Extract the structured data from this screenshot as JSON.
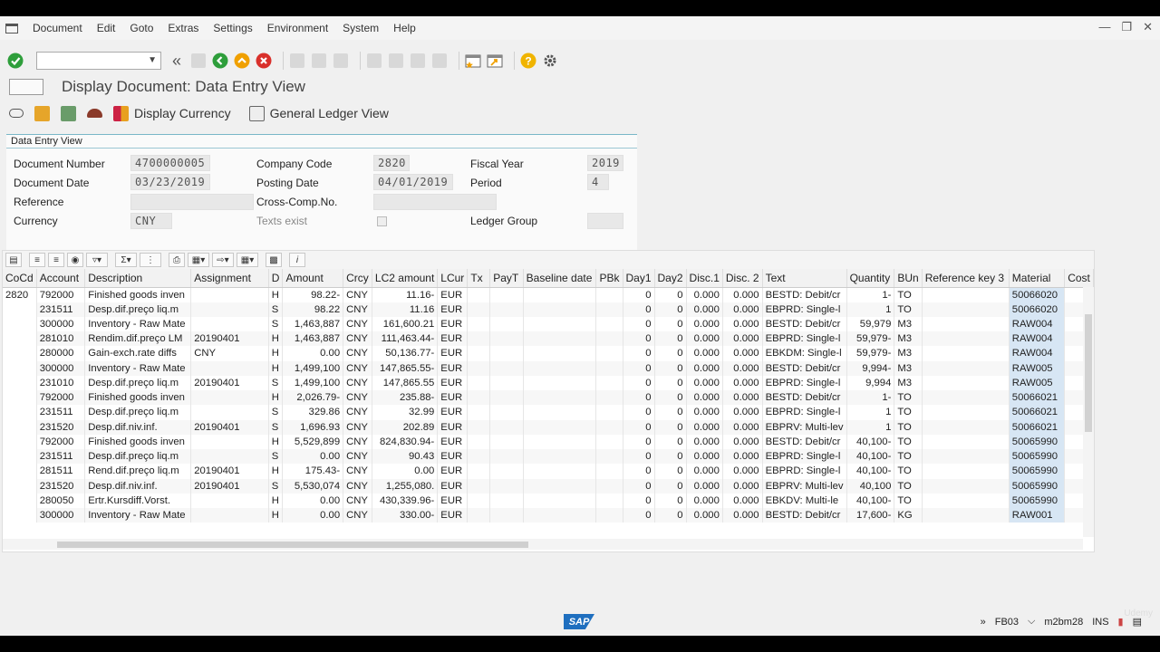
{
  "menu": [
    "Document",
    "Edit",
    "Goto",
    "Extras",
    "Settings",
    "Environment",
    "System",
    "Help"
  ],
  "title": "Display Document: Data Entry View",
  "app_toolbar": {
    "display_currency": "Display Currency",
    "general_ledger_view": "General Ledger View"
  },
  "panel": {
    "title": "Data Entry View",
    "document_number_label": "Document Number",
    "document_number": "4700000005",
    "company_code_label": "Company Code",
    "company_code": "2820",
    "fiscal_year_label": "Fiscal Year",
    "fiscal_year": "2019",
    "document_date_label": "Document Date",
    "document_date": "03/23/2019",
    "posting_date_label": "Posting Date",
    "posting_date": "04/01/2019",
    "period_label": "Period",
    "period": "4",
    "reference_label": "Reference",
    "reference": "",
    "cross_comp_label": "Cross-Comp.No.",
    "cross_comp": "",
    "currency_label": "Currency",
    "currency": "CNY",
    "texts_exist_label": "Texts exist",
    "ledger_group_label": "Ledger Group",
    "ledger_group": ""
  },
  "grid": {
    "columns": [
      "CoCd",
      "Account",
      "Description",
      "Assignment",
      "D",
      "Amount",
      "Crcy",
      "LC2 amount",
      "LCur",
      "Tx",
      "PayT",
      "Baseline date",
      "PBk",
      "Day1",
      "Day2",
      "Disc.1",
      "Disc. 2",
      "Text",
      "Quantity",
      "BUn",
      "Reference key 3",
      "Material",
      "Cost"
    ],
    "rows": [
      [
        "2820",
        "792000",
        "Finished goods inven",
        "",
        "H",
        "98.22-",
        "CNY",
        "11.16-",
        "EUR",
        "",
        "",
        "",
        "",
        "0",
        "0",
        "0.000",
        "0.000",
        "BESTD: Debit/cr",
        "1-",
        "TO",
        "",
        "50066020",
        ""
      ],
      [
        "",
        "231511",
        "Desp.dif.preço liq.m",
        "",
        "S",
        "98.22",
        "CNY",
        "11.16",
        "EUR",
        "",
        "",
        "",
        "",
        "0",
        "0",
        "0.000",
        "0.000",
        "EBPRD: Single-l",
        "1",
        "TO",
        "",
        "50066020",
        ""
      ],
      [
        "",
        "300000",
        "Inventory - Raw Mate",
        "",
        "S",
        "1,463,887",
        "CNY",
        "161,600.21",
        "EUR",
        "",
        "",
        "",
        "",
        "0",
        "0",
        "0.000",
        "0.000",
        "BESTD: Debit/cr",
        "59,979",
        "M3",
        "",
        "RAW004",
        ""
      ],
      [
        "",
        "281010",
        "Rendim.dif.preço LM",
        "20190401",
        "H",
        "1,463,887",
        "CNY",
        "111,463.44-",
        "EUR",
        "",
        "",
        "",
        "",
        "0",
        "0",
        "0.000",
        "0.000",
        "EBPRD: Single-l",
        "59,979-",
        "M3",
        "",
        "RAW004",
        ""
      ],
      [
        "",
        "280000",
        "Gain-exch.rate diffs",
        "CNY",
        "H",
        "0.00",
        "CNY",
        "50,136.77-",
        "EUR",
        "",
        "",
        "",
        "",
        "0",
        "0",
        "0.000",
        "0.000",
        "EBKDM: Single-l",
        "59,979-",
        "M3",
        "",
        "RAW004",
        ""
      ],
      [
        "",
        "300000",
        "Inventory - Raw Mate",
        "",
        "H",
        "1,499,100",
        "CNY",
        "147,865.55-",
        "EUR",
        "",
        "",
        "",
        "",
        "0",
        "0",
        "0.000",
        "0.000",
        "BESTD: Debit/cr",
        "9,994-",
        "M3",
        "",
        "RAW005",
        ""
      ],
      [
        "",
        "231010",
        "Desp.dif.preço liq.m",
        "20190401",
        "S",
        "1,499,100",
        "CNY",
        "147,865.55",
        "EUR",
        "",
        "",
        "",
        "",
        "0",
        "0",
        "0.000",
        "0.000",
        "EBPRD: Single-l",
        "9,994",
        "M3",
        "",
        "RAW005",
        ""
      ],
      [
        "",
        "792000",
        "Finished goods inven",
        "",
        "H",
        "2,026.79-",
        "CNY",
        "235.88-",
        "EUR",
        "",
        "",
        "",
        "",
        "0",
        "0",
        "0.000",
        "0.000",
        "BESTD: Debit/cr",
        "1-",
        "TO",
        "",
        "50066021",
        ""
      ],
      [
        "",
        "231511",
        "Desp.dif.preço liq.m",
        "",
        "S",
        "329.86",
        "CNY",
        "32.99",
        "EUR",
        "",
        "",
        "",
        "",
        "0",
        "0",
        "0.000",
        "0.000",
        "EBPRD: Single-l",
        "1",
        "TO",
        "",
        "50066021",
        ""
      ],
      [
        "",
        "231520",
        "Desp.dif.niv.inf.",
        "20190401",
        "S",
        "1,696.93",
        "CNY",
        "202.89",
        "EUR",
        "",
        "",
        "",
        "",
        "0",
        "0",
        "0.000",
        "0.000",
        "EBPRV: Multi-lev",
        "1",
        "TO",
        "",
        "50066021",
        ""
      ],
      [
        "",
        "792000",
        "Finished goods inven",
        "",
        "H",
        "5,529,899",
        "CNY",
        "824,830.94-",
        "EUR",
        "",
        "",
        "",
        "",
        "0",
        "0",
        "0.000",
        "0.000",
        "BESTD: Debit/cr",
        "40,100-",
        "TO",
        "",
        "50065990",
        ""
      ],
      [
        "",
        "231511",
        "Desp.dif.preço liq.m",
        "",
        "S",
        "0.00",
        "CNY",
        "90.43",
        "EUR",
        "",
        "",
        "",
        "",
        "0",
        "0",
        "0.000",
        "0.000",
        "EBPRD: Single-l",
        "40,100-",
        "TO",
        "",
        "50065990",
        ""
      ],
      [
        "",
        "281511",
        "Rend.dif.preço liq.m",
        "20190401",
        "H",
        "175.43-",
        "CNY",
        "0.00",
        "EUR",
        "",
        "",
        "",
        "",
        "0",
        "0",
        "0.000",
        "0.000",
        "EBPRD: Single-l",
        "40,100-",
        "TO",
        "",
        "50065990",
        ""
      ],
      [
        "",
        "231520",
        "Desp.dif.niv.inf.",
        "20190401",
        "S",
        "5,530,074",
        "CNY",
        "1,255,080.",
        "EUR",
        "",
        "",
        "",
        "",
        "0",
        "0",
        "0.000",
        "0.000",
        "EBPRV: Multi-lev",
        "40,100",
        "TO",
        "",
        "50065990",
        ""
      ],
      [
        "",
        "280050",
        "Ertr.Kursdiff.Vorst.",
        "",
        "H",
        "0.00",
        "CNY",
        "430,339.96-",
        "EUR",
        "",
        "",
        "",
        "",
        "0",
        "0",
        "0.000",
        "0.000",
        "EBKDV: Multi-le",
        "40,100-",
        "TO",
        "",
        "50065990",
        ""
      ],
      [
        "",
        "300000",
        "Inventory - Raw Mate",
        "",
        "H",
        "0.00",
        "CNY",
        "330.00-",
        "EUR",
        "",
        "",
        "",
        "",
        "0",
        "0",
        "0.000",
        "0.000",
        "BESTD: Debit/cr",
        "17,600-",
        "KG",
        "",
        "RAW001",
        ""
      ]
    ]
  },
  "status": {
    "transaction": "FB03",
    "system": "m2bm28",
    "mode": "INS"
  },
  "watermark": "Udemy",
  "colors": {
    "accent_green": "#2e9e3b",
    "accent_orange": "#f0a000",
    "accent_red": "#d9302b",
    "material_highlight": "#d7e6f4"
  }
}
